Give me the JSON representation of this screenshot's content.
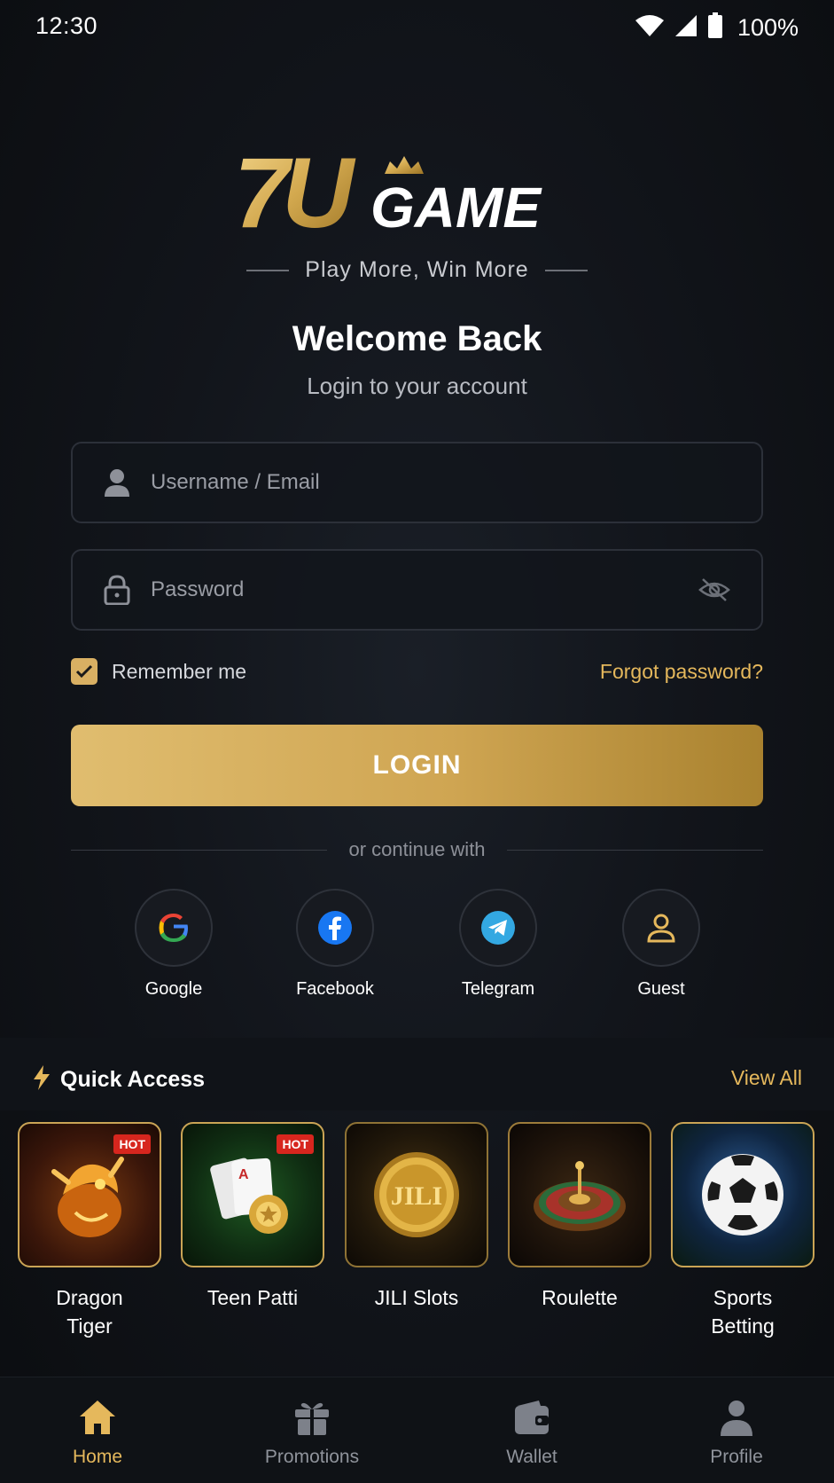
{
  "status_bar": {
    "time": "12:30",
    "battery": "100%"
  },
  "brand": {
    "logo_numeral": "7U",
    "logo_word": "GAME",
    "tagline": "Play More, Win More",
    "accent": "#d9b063"
  },
  "welcome": {
    "title": "Welcome Back",
    "subtitle": "Login to your account"
  },
  "form": {
    "username_placeholder": "Username / Email",
    "password_placeholder": "Password",
    "remember_label": "Remember me",
    "remember_checked": true,
    "forgot_label": "Forgot password?",
    "login_label": "LOGIN"
  },
  "divider_text": "or continue with",
  "social": [
    {
      "label": "Google",
      "icon": "google-icon"
    },
    {
      "label": "Facebook",
      "icon": "facebook-icon"
    },
    {
      "label": "Telegram",
      "icon": "telegram-icon"
    },
    {
      "label": "Guest",
      "icon": "guest-icon"
    }
  ],
  "quick_access": {
    "title": "Quick Access",
    "view_all": "View All",
    "games": [
      {
        "line1": "Dragon",
        "line2": "Tiger",
        "badge": "HOT",
        "icon": "dragon-icon"
      },
      {
        "line1": "Teen Patti",
        "line2": "",
        "badge": "HOT",
        "icon": "cards-icon"
      },
      {
        "line1": "JILI Slots",
        "line2": "",
        "badge": "",
        "icon": "jili-coin-icon",
        "coin_text": "JILI"
      },
      {
        "line1": "Roulette",
        "line2": "",
        "badge": "",
        "icon": "roulette-icon"
      },
      {
        "line1": "Sports",
        "line2": "Betting",
        "badge": "",
        "icon": "soccer-ball-icon"
      }
    ]
  },
  "nav": [
    {
      "label": "Home",
      "icon": "home-icon",
      "active": true
    },
    {
      "label": "Promotions",
      "icon": "gift-icon",
      "active": false
    },
    {
      "label": "Wallet",
      "icon": "wallet-icon",
      "active": false
    },
    {
      "label": "Profile",
      "icon": "profile-icon",
      "active": false
    }
  ]
}
